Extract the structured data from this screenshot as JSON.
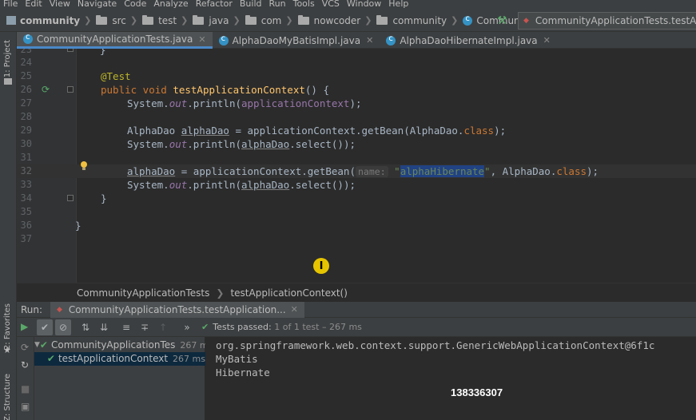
{
  "menu": [
    "File",
    "Edit",
    "View",
    "Navigate",
    "Code",
    "Analyze",
    "Refactor",
    "Build",
    "Run",
    "Tools",
    "VCS",
    "Window",
    "Help"
  ],
  "breadcrumb": [
    "community",
    "src",
    "test",
    "java",
    "com",
    "nowcoder",
    "community",
    "CommunityApplicationTests"
  ],
  "run_config": "CommunityApplicationTests.testApplicationContext",
  "left_strip": {
    "project": "1: Project",
    "favorites": "2: Favorites",
    "structure": "Z: Structure"
  },
  "tabs": [
    {
      "label": "CommunityApplicationTests.java",
      "active": true
    },
    {
      "label": "AlphaDaoMyBatisImpl.java",
      "active": false
    },
    {
      "label": "AlphaDaoHibernateImpl.java",
      "active": false
    }
  ],
  "line_numbers": [
    "23",
    "24",
    "25",
    "26",
    "27",
    "28",
    "29",
    "30",
    "31",
    "32",
    "33",
    "34",
    "35",
    "36",
    "37"
  ],
  "code": {
    "l23": "}",
    "l25_ann": "@Test",
    "l26_kw": "public void ",
    "l26_mth": "testApplicationContext",
    "l26_rest": "() {",
    "l27_a": "System.",
    "l27_out": "out",
    "l27_b": ".println(",
    "l27_arg": "applicationContext",
    "l27_c": ");",
    "l29_a": "AlphaDao ",
    "l29_var": "alphaDao",
    "l29_b": " = applicationContext.getBean(AlphaDao.",
    "l29_kw": "class",
    "l29_c": ");",
    "l30_a": "System.",
    "l30_out": "out",
    "l30_b": ".println(",
    "l30_var": "alphaDao",
    "l30_c": ".select());",
    "l32_var": "alphaDao",
    "l32_a": " = applicationContext.getBean(",
    "l32_hint": "name:",
    "l32_q1": "\"",
    "l32_str": "alphaHibernate",
    "l32_q2": "\"",
    "l32_b": ", AlphaDao.",
    "l32_kw": "class",
    "l32_c": ");",
    "l33_a": "System.",
    "l33_out": "out",
    "l33_b": ".println(",
    "l33_var": "alphaDao",
    "l33_c": ".select());",
    "l34": "}",
    "l36": "}"
  },
  "editor_breadcrumb": [
    "CommunityApplicationTests",
    "testApplicationContext()"
  ],
  "run": {
    "label": "Run:",
    "tab": "CommunityApplicationTests.testApplication...",
    "status": "Tests passed:",
    "status_detail": "1 of 1 test – 267 ms",
    "tree": [
      {
        "label": "CommunityApplicationTes",
        "time": "267 ms"
      },
      {
        "label": "testApplicationContext",
        "time": "267 ms"
      }
    ],
    "console": [
      "org.springframework.web.context.support.GenericWebApplicationContext@6f1c",
      "MyBatis",
      "Hibernate"
    ]
  },
  "overlay_number": "138336307"
}
